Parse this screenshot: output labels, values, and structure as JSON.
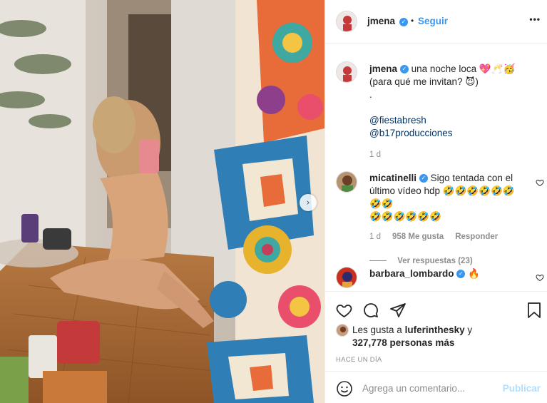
{
  "post": {
    "username": "jmena",
    "follow_label": "Seguir",
    "more_label": "•••",
    "separator": "•"
  },
  "caption": {
    "username": "jmena",
    "line1": "una noche loca 💖🥂🥳",
    "line2": "(para qué me invitan? 😈)",
    "line3": ".",
    "mention1": "@fiestabresh",
    "mention2": "@b17producciones",
    "time": "1 d"
  },
  "comments": [
    {
      "username": "micatinelli",
      "line1": "Sigo tentada con el",
      "line2": "último vídeo hdp 🤣🤣🤣🤣🤣🤣🤣🤣",
      "line3": "🤣🤣🤣🤣🤣🤣",
      "time": "1 d",
      "likes": "958 Me gusta",
      "reply": "Responder",
      "view_replies": "Ver respuestas (23)"
    },
    {
      "username": "barbara_lombardo",
      "text": "🔥"
    }
  ],
  "likes": {
    "prefix": "Les gusta a",
    "user": "luferinthesky",
    "connector": "y",
    "count": "327,778 personas más"
  },
  "time_ago": "HACE UN DÍA",
  "comment_box": {
    "placeholder": "Agrega un comentario...",
    "publish": "Publicar"
  },
  "icons": {
    "verified": "verified-badge-icon",
    "heart": "heart-icon",
    "comment": "comment-icon",
    "share": "share-icon",
    "save": "bookmark-icon",
    "emoji": "emoji-icon",
    "next": "chevron-right-icon"
  },
  "colors": {
    "accent": "#3897f0",
    "link": "#003569",
    "muted": "#8e8e8e"
  }
}
